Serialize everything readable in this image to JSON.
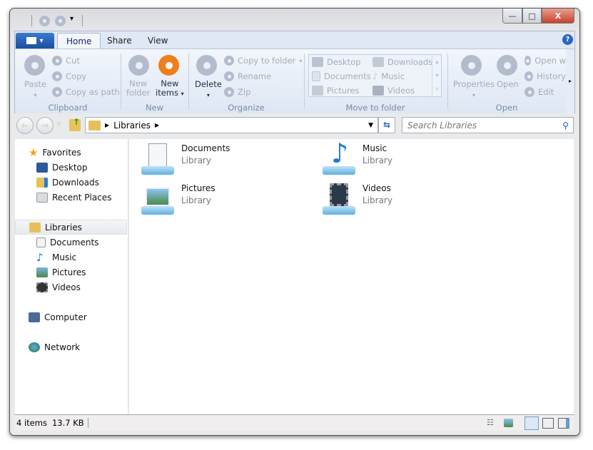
{
  "window": {
    "controls": {
      "minimize": "—",
      "maximize": "□",
      "close": "X"
    }
  },
  "ribbon": {
    "file_menu_icon": "file-menu-icon",
    "tabs": [
      {
        "label": "Home",
        "active": true
      },
      {
        "label": "Share"
      },
      {
        "label": "View"
      }
    ],
    "help": "?",
    "groups": {
      "clipboard": {
        "name": "Clipboard",
        "paste": "Paste",
        "cut": "Cut",
        "copy": "Copy",
        "copy_as_path": "Copy as path"
      },
      "new": {
        "name": "New",
        "new_folder": [
          "New",
          "folder"
        ],
        "new_items": [
          "New",
          "items"
        ]
      },
      "organize": {
        "name": "Organize",
        "delete": "Delete",
        "copy_to_folder": "Copy to folder",
        "rename": "Rename",
        "zip": "Zip"
      },
      "move": {
        "name": "Move to folder",
        "items": [
          "Desktop",
          "Downloads",
          "Documents",
          "Music",
          "Pictures",
          "Videos"
        ]
      },
      "open": {
        "name": "Open",
        "properties": "Properties",
        "open": "Open",
        "open_with": "Open w",
        "history": "History",
        "edit": "Edit"
      }
    }
  },
  "address": {
    "crumb": "Libraries",
    "search_placeholder": "Search Libraries"
  },
  "nav": {
    "favorites": "Favorites",
    "fav_items": [
      "Desktop",
      "Downloads",
      "Recent Places"
    ],
    "libraries": "Libraries",
    "lib_items": [
      "Documents",
      "Music",
      "Pictures",
      "Videos"
    ],
    "computer": "Computer",
    "network": "Network"
  },
  "content": [
    {
      "name": "Documents",
      "type": "Library"
    },
    {
      "name": "Music",
      "type": "Library"
    },
    {
      "name": "Pictures",
      "type": "Library"
    },
    {
      "name": "Videos",
      "type": "Library"
    }
  ],
  "status": {
    "items": "4 items",
    "size": "13.7 KB"
  },
  "colors": {
    "accent": "#1f5fb3",
    "orange": "#ef7f1a"
  }
}
